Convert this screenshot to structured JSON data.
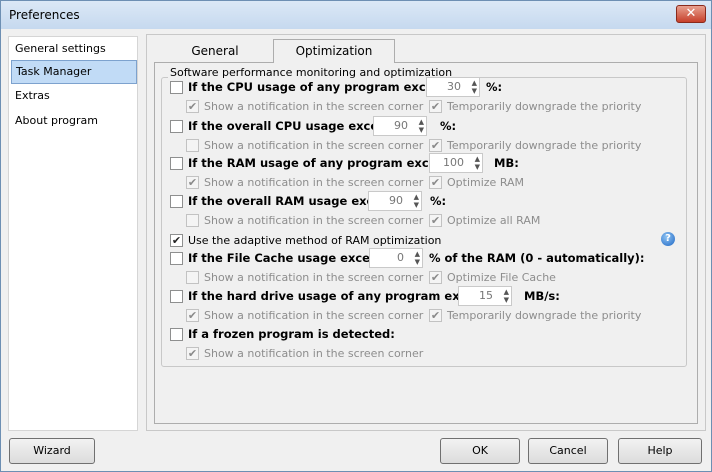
{
  "window": {
    "title": "Preferences",
    "close_label": "✕"
  },
  "nav": {
    "items": [
      {
        "label": "General settings"
      },
      {
        "label": "Task Manager",
        "selected": true
      },
      {
        "label": "Extras"
      },
      {
        "label": "About program"
      }
    ]
  },
  "tabs": [
    {
      "label": "General"
    },
    {
      "label": "Optimization",
      "active": true
    }
  ],
  "group_title": "Software performance monitoring and optimization",
  "rows": [
    {
      "label": "If the CPU usage of any program exceeds",
      "checked": false,
      "value": "30",
      "unit": "%:",
      "subs": [
        {
          "label": "Show a notification in the screen corner",
          "checked": true
        },
        {
          "label": "Temporarily downgrade the priority",
          "checked": true
        }
      ]
    },
    {
      "label": "If the overall CPU usage exceeds",
      "checked": false,
      "value": "90",
      "unit": "%:",
      "subs": [
        {
          "label": "Show a notification in the screen corner",
          "checked": false
        },
        {
          "label": "Temporarily downgrade the priority",
          "checked": true
        }
      ]
    },
    {
      "label": "If the RAM usage of any program exceeds",
      "checked": false,
      "value": "100",
      "unit": "MB:",
      "subs": [
        {
          "label": "Show a notification in the screen corner",
          "checked": true
        },
        {
          "label": "Optimize RAM",
          "checked": true
        }
      ]
    },
    {
      "label": "If the overall RAM usage exceeds",
      "checked": false,
      "value": "90",
      "unit": "%:",
      "subs": [
        {
          "label": "Show a notification in the screen corner",
          "checked": false
        },
        {
          "label": "Optimize all RAM",
          "checked": true
        }
      ]
    },
    {
      "label": "Use the adaptive method of RAM optimization",
      "checked": true,
      "plain": true
    },
    {
      "label": "If the File Cache usage exceeds",
      "checked": false,
      "value": "0",
      "unit": "% of the RAM (0 - automatically):",
      "subs": [
        {
          "label": "Show a notification in the screen corner",
          "checked": false
        },
        {
          "label": "Optimize File Cache",
          "checked": true
        }
      ]
    },
    {
      "label": "If the hard drive usage of any program exceeds",
      "checked": false,
      "value": "15",
      "unit": "MB/s:",
      "subs": [
        {
          "label": "Show a notification in the screen corner",
          "checked": true
        },
        {
          "label": "Temporarily downgrade the priority",
          "checked": true
        }
      ]
    },
    {
      "label": "If a frozen program is detected:",
      "checked": false,
      "subs": [
        {
          "label": "Show a notification in the screen corner",
          "checked": true
        }
      ]
    }
  ],
  "help_icon": "?",
  "buttons": {
    "wizard": "Wizard",
    "ok": "OK",
    "cancel": "Cancel",
    "help": "Help"
  }
}
